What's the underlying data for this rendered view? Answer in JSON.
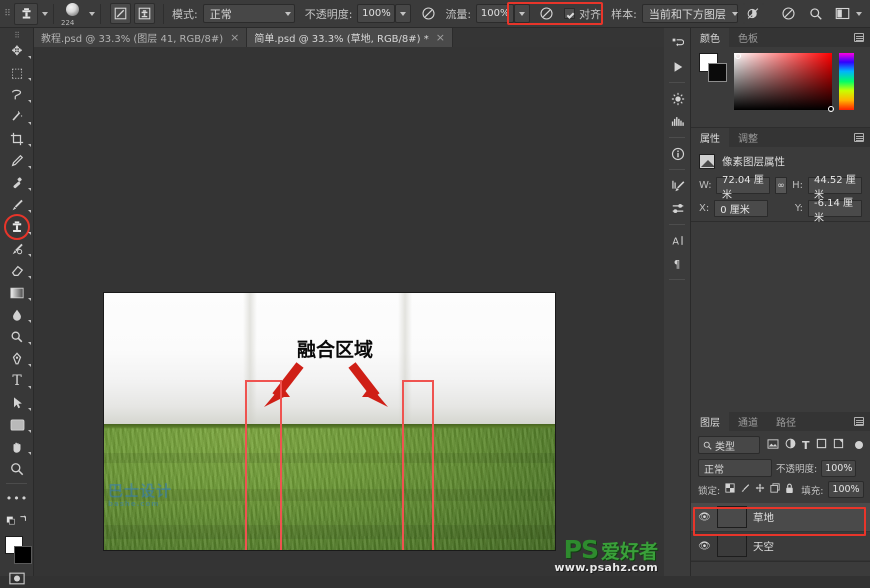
{
  "app": {
    "name": "Adobe Photoshop"
  },
  "options_bar": {
    "tool_icon": "clone-stamp-icon",
    "brush_size": "224",
    "toggle_brush_panel_icon": "brush-panel-icon",
    "toggle_clone_source_icon": "clone-source-icon",
    "mode_label": "模式:",
    "mode_value": "正常",
    "opacity_label": "不透明度:",
    "opacity_value": "100%",
    "airbrush_icon": "airbrush-icon",
    "flow_label": "流量:",
    "flow_value": "100%",
    "smoothing_icon": "smoothing-icon",
    "align_label": "对齐",
    "align_checked": true,
    "sample_label": "样本:",
    "sample_value": "当前和下方图层",
    "ignore_adjust_icon": "ignore-adjustment-layers-icon",
    "tablet_pressure_icon": "tablet-pressure-icon",
    "search_icon": "search-icon",
    "workspace_icon": "workspace-switcher-icon",
    "highlight_color": "#e8352a"
  },
  "tabs": [
    {
      "label": "教程.psd @ 33.3% (图层 41, RGB/8#)",
      "close": "×",
      "active": false
    },
    {
      "label": "简单.psd @ 33.3% (草地, RGB/8#) *",
      "close": "×",
      "active": true
    }
  ],
  "toolbox": {
    "tools": [
      {
        "name": "move-tool",
        "glyph": "✥"
      },
      {
        "name": "rectangular-marquee-tool",
        "glyph": "⬚"
      },
      {
        "name": "lasso-tool",
        "glyph": "𝒮"
      },
      {
        "name": "magic-wand-tool",
        "glyph": "✨"
      },
      {
        "name": "crop-tool",
        "glyph": "⛶"
      },
      {
        "name": "eyedropper-tool",
        "glyph": "✐"
      },
      {
        "name": "spot-healing-brush-tool",
        "glyph": "⚕"
      },
      {
        "name": "brush-tool",
        "glyph": "🖌"
      },
      {
        "name": "clone-stamp-tool",
        "glyph": "⬤"
      },
      {
        "name": "history-brush-tool",
        "glyph": "❧"
      },
      {
        "name": "eraser-tool",
        "glyph": "◗"
      },
      {
        "name": "gradient-tool",
        "glyph": "▭"
      },
      {
        "name": "blur-tool",
        "glyph": "💧"
      },
      {
        "name": "dodge-tool",
        "glyph": "✎"
      },
      {
        "name": "pen-tool",
        "glyph": "✒"
      },
      {
        "name": "type-tool",
        "glyph": "T"
      },
      {
        "name": "path-selection-tool",
        "glyph": "➤"
      },
      {
        "name": "rectangle-tool",
        "glyph": "▢"
      },
      {
        "name": "hand-tool",
        "glyph": "✋"
      },
      {
        "name": "zoom-tool",
        "glyph": "🔍"
      },
      {
        "name": "edit-toolbar-tool",
        "glyph": "•••"
      }
    ],
    "selected_tool": "clone-stamp-tool",
    "quick-mask": "quick-mask-icon",
    "screen-mode": "screen-mode-icon",
    "foreground_color": "#ffffff",
    "background_color": "#000000"
  },
  "canvas": {
    "annotation_label": "融合区域",
    "arrow_count": 2,
    "rect_count": 2,
    "watermark_left": "巴士设计",
    "watermark_left_sub": "bashe.com",
    "watermark_ps": "PS",
    "watermark_cn": "爱好者",
    "watermark_url": "www.psahz.com"
  },
  "icon_dock": {
    "icons": [
      {
        "name": "history-icon",
        "glyph": "↺"
      },
      {
        "name": "actions-play-icon",
        "glyph": "▶"
      },
      {
        "name": "adjustments-icon",
        "glyph": "✺"
      },
      {
        "name": "histogram-icon",
        "glyph": "▥"
      },
      {
        "name": "info-icon",
        "glyph": "ⓘ"
      },
      {
        "name": "brush-settings-icon",
        "glyph": "🖌"
      },
      {
        "name": "brush-presets-icon",
        "glyph": "⇄"
      },
      {
        "name": "character-icon",
        "glyph": "A"
      },
      {
        "name": "paragraph-icon",
        "glyph": "¶"
      }
    ]
  },
  "color_panel": {
    "tabs": [
      {
        "label": "颜色",
        "active": true
      },
      {
        "label": "色板",
        "active": false
      }
    ],
    "menu_icon": "panel-menu-icon",
    "foreground_color": "#ffffff",
    "background_color": "#0b0b0b"
  },
  "properties_panel": {
    "tabs": [
      {
        "label": "属性",
        "active": true
      },
      {
        "label": "调整",
        "active": false
      }
    ],
    "menu_icon": "panel-menu-icon",
    "thumb_icon": "pixel-layer-icon",
    "title": "像素图层属性",
    "fields": [
      {
        "key": "W:",
        "value": "72.04 厘米"
      },
      {
        "key": "H:",
        "value": "44.52 厘米"
      },
      {
        "key": "X:",
        "value": "0 厘米"
      },
      {
        "key": "Y:",
        "value": "-6.14 厘米"
      }
    ],
    "link_icon": "link-dimensions-icon"
  },
  "layers_panel": {
    "tabs": [
      {
        "label": "图层",
        "active": true
      },
      {
        "label": "通道",
        "active": false
      },
      {
        "label": "路径",
        "active": false
      }
    ],
    "menu_icon": "panel-menu-icon",
    "filter_icon": "search-icon",
    "filter_value": "类型",
    "filter_type_icons": [
      {
        "name": "filter-pixel-icon",
        "glyph": "🖼"
      },
      {
        "name": "filter-adjustment-icon",
        "glyph": "◐"
      },
      {
        "name": "filter-type-icon",
        "glyph": "T"
      },
      {
        "name": "filter-shape-icon",
        "glyph": "▢"
      },
      {
        "name": "filter-smart-object-icon",
        "glyph": "◨"
      }
    ],
    "filter_toggle_icon": "filter-toggle-icon",
    "blend_mode": "正常",
    "opacity_label": "不透明度:",
    "opacity_value": "100%",
    "lock_label": "锁定:",
    "lock_icons": [
      {
        "name": "lock-transparency-icon",
        "glyph": "▩"
      },
      {
        "name": "lock-image-icon",
        "glyph": "🖌"
      },
      {
        "name": "lock-position-icon",
        "glyph": "✥"
      },
      {
        "name": "lock-nesting-icon",
        "glyph": "⌸"
      },
      {
        "name": "lock-all-icon",
        "glyph": "🔒"
      }
    ],
    "fill_label": "填充:",
    "fill_value": "100%",
    "layers": [
      {
        "name": "草地",
        "visible": true,
        "selected": true,
        "thumb": "grass"
      },
      {
        "name": "天空",
        "visible": true,
        "selected": false,
        "thumb": "sky"
      }
    ],
    "highlight_color": "#e8352a"
  }
}
